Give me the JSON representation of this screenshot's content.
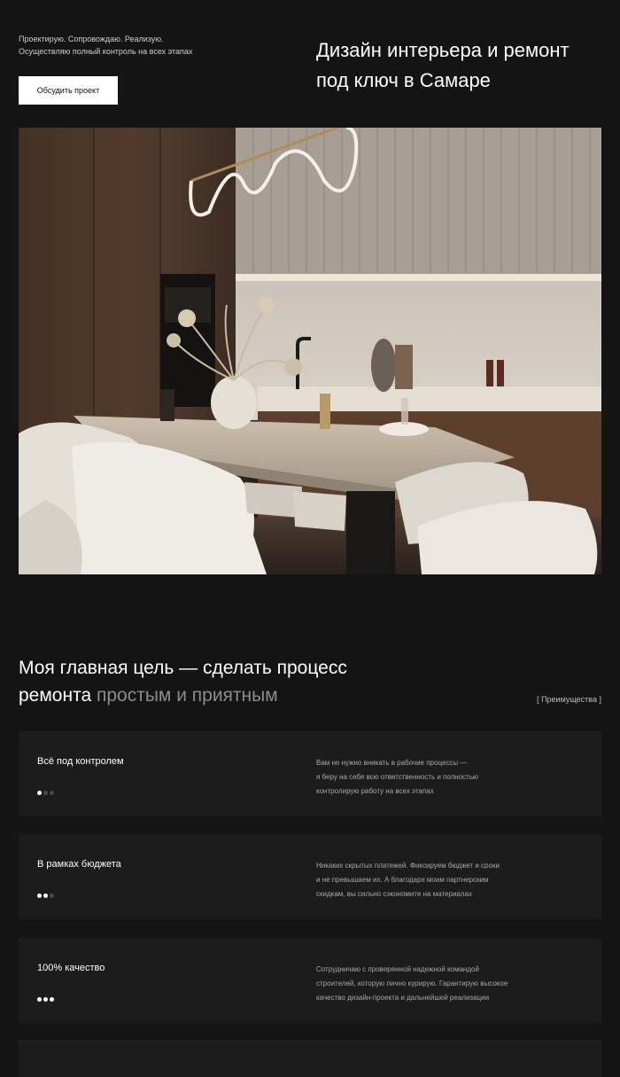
{
  "hero": {
    "tagline_line1": "Проектирую. Сопровождаю. Реализую.",
    "tagline_line2": "Осуществляю полный контроль на всех этапах",
    "cta_label": "Обсудить проект",
    "title_line1": "Дизайн интерьера и ремонт",
    "title_line2": "под ключ в Самаре"
  },
  "goal": {
    "line1": "Моя главная цель — сделать процесс",
    "line2_white": "ремонта",
    "line2_muted": "простым и приятным",
    "tag": "[ Преимущества ]"
  },
  "cards": [
    {
      "title": "Всё под контролем",
      "desc": [
        "Вам не нужно вникать в рабочие процессы —",
        "я беру на себя всю ответственность и полностью",
        "контролирую работу на всех этапах"
      ],
      "dots_active": 1
    },
    {
      "title": "В рамках бюджета",
      "desc": [
        "Никаких скрытых платежей. Фиксируем бюджет и сроки",
        "и не превышаем их. А благодаря моим партнерским",
        "скидкам, вы сильно сэкономите на материалах"
      ],
      "dots_active": 2
    },
    {
      "title": "100% качество",
      "desc": [
        "Сотрудничаю с проверенной надежной командой",
        "строителей, которую лично курирую. Гарантирую высокое",
        "качество дизайн-проекта и дальнейшей реализации"
      ],
      "dots_active": 3
    }
  ],
  "colors": {
    "background": "#141414",
    "card": "#1c1c1c",
    "accent_muted": "#8c8c8c"
  }
}
